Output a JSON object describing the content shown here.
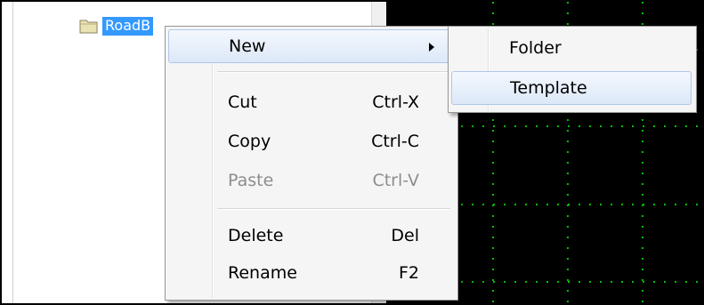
{
  "tree": {
    "node_label": "RoadB"
  },
  "context_menu": {
    "items": [
      {
        "label": "New",
        "shortcut": ""
      },
      {
        "label": "Cut",
        "shortcut": "Ctrl-X"
      },
      {
        "label": "Copy",
        "shortcut": "Ctrl-C"
      },
      {
        "label": "Paste",
        "shortcut": "Ctrl-V"
      },
      {
        "label": "Delete",
        "shortcut": "Del"
      },
      {
        "label": "Rename",
        "shortcut": "F2"
      }
    ]
  },
  "submenu": {
    "items": [
      {
        "label": "Folder"
      },
      {
        "label": "Template"
      }
    ]
  },
  "colors": {
    "selection": "#3399ff",
    "canvas_bg": "#000000",
    "grid": "#00c000",
    "menu_bg": "#f5f5f5",
    "disabled_text": "#8d8d8d"
  },
  "icons": {
    "tree_node": "folder-icon",
    "submenu_indicator": "chevron-right-icon"
  }
}
